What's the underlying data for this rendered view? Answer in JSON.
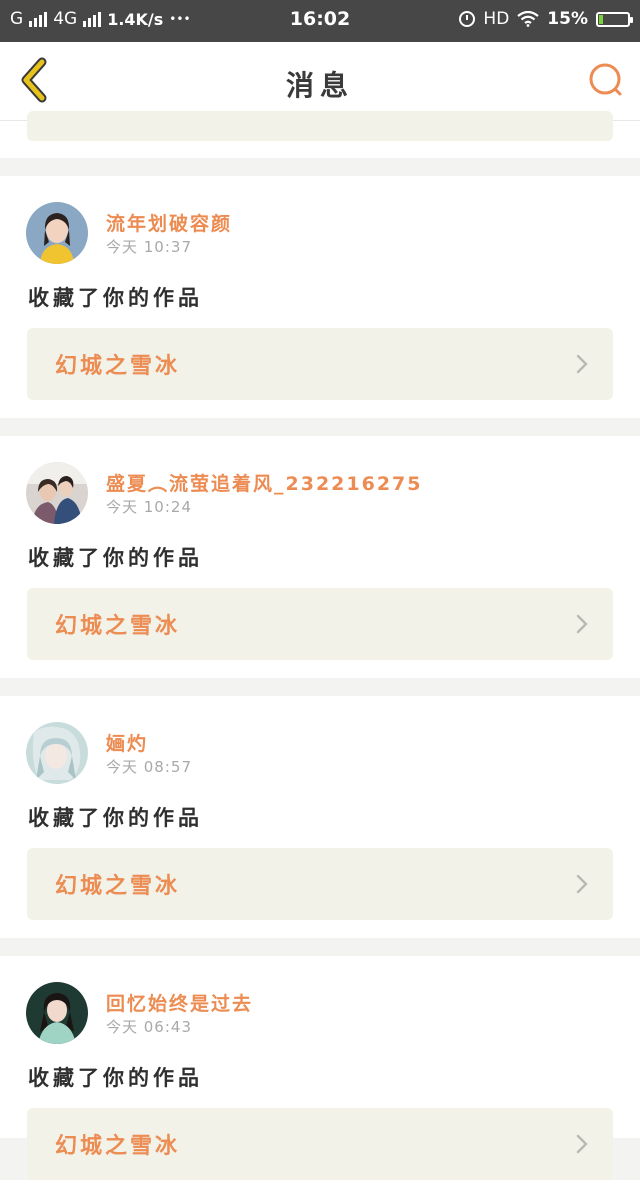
{
  "status_bar": {
    "carrier": "G",
    "network": "4G",
    "speed": "1.4K/s",
    "dots": "•••",
    "time": "16:02",
    "hd": "HD",
    "battery": "15%",
    "battery_level": 0.15
  },
  "header": {
    "title": "消息",
    "back_icon": "chevron-left-icon",
    "search_icon": "search-icon"
  },
  "top_partial": {
    "work_title": ""
  },
  "messages": [
    {
      "username": "流年划破容颜",
      "time": "今天 10:37",
      "action": "收藏了你的作品",
      "work_title": "幻城之雪冰"
    },
    {
      "username": "盛夏︵流萤追着风_232216275",
      "time": "今天 10:24",
      "action": "收藏了你的作品",
      "work_title": "幻城之雪冰"
    },
    {
      "username": "婳灼",
      "time": "今天 08:57",
      "action": "收藏了你的作品",
      "work_title": "幻城之雪冰"
    },
    {
      "username": "回忆始终是过去",
      "time": "今天 06:43",
      "action": "收藏了你的作品",
      "work_title": "幻城之雪冰"
    }
  ],
  "colors": {
    "accent": "#ec8c52",
    "back_icon": "#e6c21a",
    "status_bar": "#474747",
    "work_bar": "#f2f2e9"
  }
}
